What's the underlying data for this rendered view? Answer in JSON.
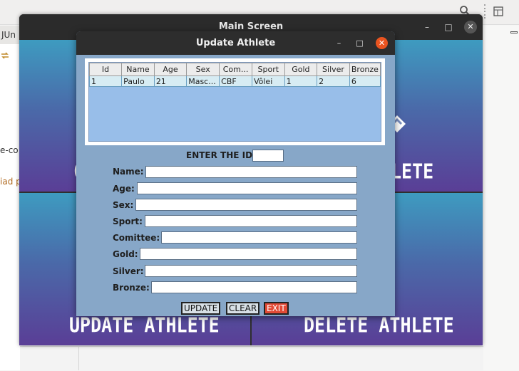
{
  "ide": {
    "tab_label": "JUn",
    "left_snippets": [
      "e-co",
      "iad p"
    ]
  },
  "main_window": {
    "title": "Main Screen",
    "tiles": {
      "update_label": "UPDATE ATHLETE",
      "delete_label": "DELETE ATHLETE",
      "top_right_partial": "LETE",
      "top_left_partial": "C"
    }
  },
  "dialog": {
    "title": "Update Athlete",
    "table": {
      "columns": [
        "Id",
        "Name",
        "Age",
        "Sex",
        "Com...",
        "Sport",
        "Gold",
        "Silver",
        "Bronze"
      ],
      "rows": [
        [
          "1",
          "Paulo",
          "21",
          "Masc...",
          "CBF",
          "Vôlei",
          "1",
          "2",
          "6"
        ]
      ]
    },
    "enter_id_label": "ENTER THE ID:",
    "id_value": "",
    "fields": {
      "name_label": "Name:",
      "age_label": "Age:",
      "sex_label": "Sex:",
      "sport_label": "Sport:",
      "comittee_label": "Comittee:",
      "gold_label": "Gold:",
      "silver_label": "Silver:",
      "bronze_label": "Bronze:"
    },
    "buttons": {
      "update": "UPDATE",
      "clear": "CLEAR",
      "exit": "EXIT"
    }
  },
  "colors": {
    "dialog_bg": "#87a7c8",
    "table_bg": "#98bee9",
    "exit_button": "#e24a36",
    "close_button": "#e95420"
  }
}
